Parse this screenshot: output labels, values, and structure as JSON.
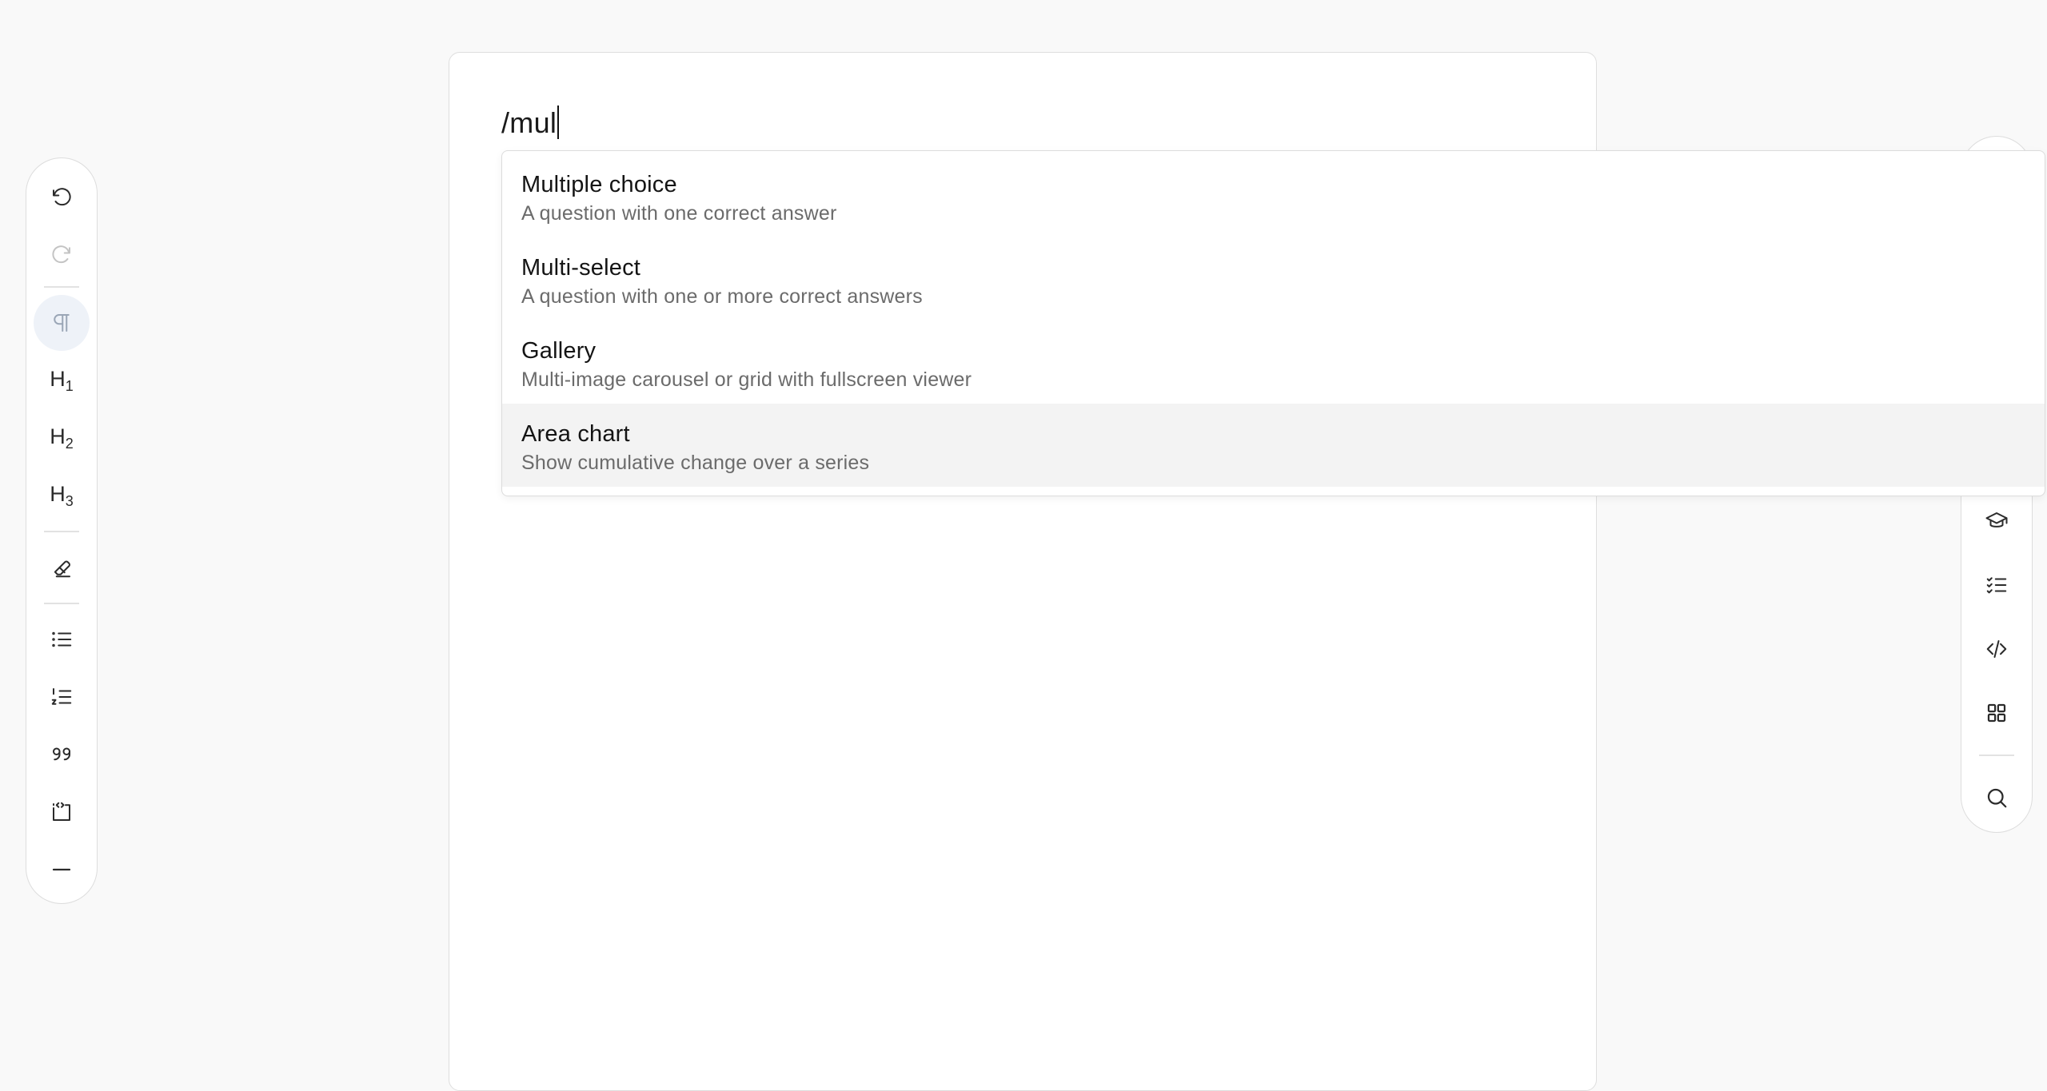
{
  "editor": {
    "typed_text": "/mul"
  },
  "slash_menu": {
    "items": [
      {
        "title": "Multiple choice",
        "description": "A question with one correct answer"
      },
      {
        "title": "Multi-select",
        "description": "A question with one or more correct answers"
      },
      {
        "title": "Gallery",
        "description": "Multi-image carousel or grid with fullscreen viewer"
      },
      {
        "title": "Area chart",
        "description": "Show cumulative change over a series"
      }
    ],
    "highlighted_index": 3
  },
  "left_toolbar": {
    "buttons": [
      {
        "icon": "undo-icon"
      },
      {
        "icon": "redo-icon",
        "state": "disabled"
      },
      {
        "icon": "paragraph-icon",
        "state": "active"
      },
      {
        "icon": "heading-1-icon",
        "glyph": "H",
        "sub": "1"
      },
      {
        "icon": "heading-2-icon",
        "glyph": "H",
        "sub": "2"
      },
      {
        "icon": "heading-3-icon",
        "glyph": "H",
        "sub": "3"
      },
      {
        "icon": "eraser-icon"
      },
      {
        "icon": "bullet-list-icon"
      },
      {
        "icon": "numbered-list-icon"
      },
      {
        "icon": "quote-icon"
      },
      {
        "icon": "code-block-icon"
      },
      {
        "icon": "horizontal-rule-icon"
      }
    ]
  },
  "right_toolbar": {
    "buttons": [
      {
        "icon": "graduation-cap-icon"
      },
      {
        "icon": "checklist-icon"
      },
      {
        "icon": "code-icon"
      },
      {
        "icon": "grid-icon"
      },
      {
        "icon": "search-icon"
      }
    ]
  },
  "colors": {
    "background": "#f9f9f9",
    "card": "#ffffff",
    "highlight": "#f3f3f3",
    "active_button": "#eef2f8",
    "text_secondary": "#6b6b6b"
  }
}
